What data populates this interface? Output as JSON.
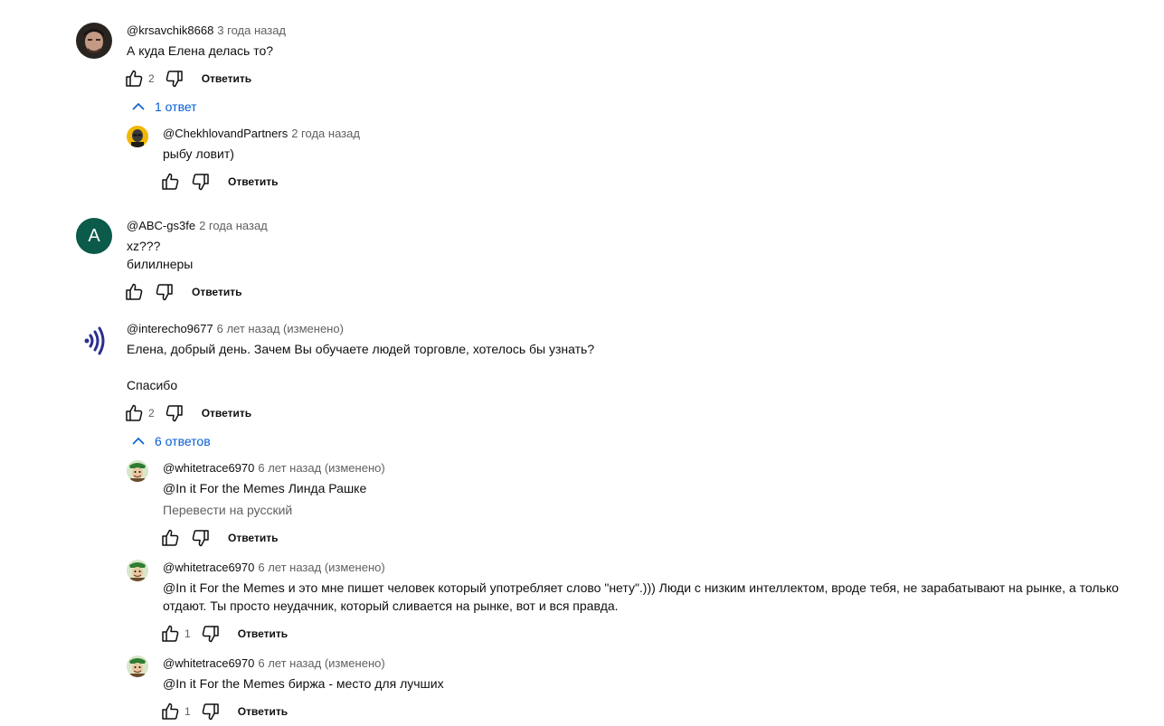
{
  "actions": {
    "reply_label": "Ответить"
  },
  "comments": [
    {
      "author": "@krsavchik8668",
      "time": "3 года назад",
      "lines": [
        "А куда Елена делась то?"
      ],
      "likes": "2",
      "replies_toggle": "1 ответ",
      "replies": [
        {
          "author": "@ChekhlovandPartners",
          "time": "2 года назад",
          "lines": [
            "рыбу ловит)"
          ]
        }
      ]
    },
    {
      "author": "@ABC-gs3fe",
      "time": "2 года назад",
      "avatar_letter": "A",
      "avatar_color": "#0b5a4a",
      "lines": [
        "xz???",
        "билилнеры"
      ]
    },
    {
      "author": "@interecho9677",
      "time": "6 лет назад (изменено)",
      "lines": [
        "Елена, добрый день. Зачем Вы обучаете людей торговле, хотелось бы узнать?",
        "Спасибо"
      ],
      "likes": "2",
      "replies_toggle": "6 ответов",
      "replies": [
        {
          "author": "@whitetrace6970",
          "time": "6 лет назад (изменено)",
          "lines": [
            "@In it For the Memes Линда Рашке"
          ],
          "translate": "Перевести на русский"
        },
        {
          "author": "@whitetrace6970",
          "time": "6 лет назад (изменено)",
          "lines": [
            "@In it For the Memes и это мне пишет человек который употребляет слово \"нету\".))) Люди с низким интеллектом, вроде тебя, не зарабатывают на рынке, а только отдают. Ты просто неудачник, который сливается на рынке, вот и вся правда."
          ],
          "likes": "1"
        },
        {
          "author": "@whitetrace6970",
          "time": "6 лет назад (изменено)",
          "lines": [
            "@In it For the Memes биржа - место для лучших"
          ],
          "likes": "1"
        }
      ]
    }
  ],
  "colors": {
    "link_blue": "#065fd4",
    "secondary_text": "#606060",
    "echo_logo": "#2b2f8f"
  }
}
